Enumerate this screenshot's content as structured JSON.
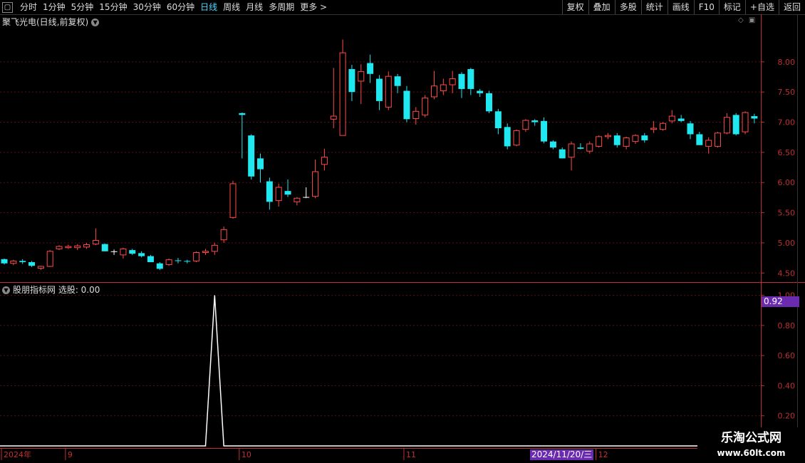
{
  "toolbar": {
    "tabs": [
      "分时",
      "1分钟",
      "5分钟",
      "15分钟",
      "30分钟",
      "60分钟",
      "日线",
      "周线",
      "月线",
      "多周期",
      "更多 >"
    ],
    "active_tab": "日线",
    "right_buttons": [
      "复权",
      "叠加",
      "多股",
      "统计",
      "画线",
      "F10",
      "标记",
      "+自选",
      "返回"
    ]
  },
  "stock": {
    "title": "聚飞光电(日线,前复权)"
  },
  "indicator": {
    "title": "股朋指标网 选股: 0.00",
    "current_value": "0.92"
  },
  "watermark": {
    "line1": "乐淘公式网",
    "line2": "www.60lt.com"
  },
  "cursor_date": "2024/11/20/三",
  "colors": {
    "up": "#ff4a4a",
    "down": "#20e8f0",
    "grid": "#5a1010",
    "axis": "#c03030"
  },
  "chart_data": [
    {
      "type": "candlestick",
      "ylim": [
        4.35,
        8.6
      ],
      "y_ticks": [
        4.5,
        5.0,
        5.5,
        6.0,
        6.5,
        7.0,
        7.5,
        8.0
      ],
      "x_ticks": [
        "2024年",
        "9",
        "10",
        "11",
        "12"
      ],
      "x_tick_index": [
        0,
        7,
        26,
        44,
        65
      ],
      "ohlc": [
        [
          4.73,
          4.74,
          4.64,
          4.66
        ],
        [
          4.66,
          4.72,
          4.63,
          4.7
        ],
        [
          4.7,
          4.73,
          4.65,
          4.68
        ],
        [
          4.68,
          4.7,
          4.6,
          4.62
        ],
        [
          4.58,
          4.62,
          4.55,
          4.61
        ],
        [
          4.61,
          4.88,
          4.6,
          4.86
        ],
        [
          4.9,
          4.96,
          4.88,
          4.94
        ],
        [
          4.92,
          4.97,
          4.9,
          4.94
        ],
        [
          4.92,
          4.98,
          4.88,
          4.95
        ],
        [
          4.93,
          5.0,
          4.9,
          4.97
        ],
        [
          4.98,
          5.24,
          4.96,
          5.04
        ],
        [
          4.98,
          4.99,
          4.86,
          4.86
        ],
        [
          4.86,
          4.89,
          4.8,
          4.86
        ],
        [
          4.8,
          4.92,
          4.74,
          4.9
        ],
        [
          4.88,
          4.9,
          4.8,
          4.82
        ],
        [
          4.83,
          4.86,
          4.76,
          4.78
        ],
        [
          4.78,
          4.8,
          4.68,
          4.68
        ],
        [
          4.66,
          4.68,
          4.55,
          4.57
        ],
        [
          4.64,
          4.74,
          4.62,
          4.72
        ],
        [
          4.71,
          4.75,
          4.66,
          4.7
        ],
        [
          4.7,
          4.72,
          4.66,
          4.69
        ],
        [
          4.7,
          4.86,
          4.68,
          4.84
        ],
        [
          4.84,
          4.9,
          4.8,
          4.86
        ],
        [
          4.86,
          5.0,
          4.8,
          4.96
        ],
        [
          5.05,
          5.27,
          5.0,
          5.22
        ],
        [
          5.42,
          6.03,
          5.4,
          5.98
        ],
        [
          7.15,
          7.16,
          6.4,
          7.12
        ],
        [
          6.78,
          6.8,
          6.05,
          6.1
        ],
        [
          6.4,
          6.48,
          6.0,
          6.22
        ],
        [
          6.02,
          6.08,
          5.55,
          5.68
        ],
        [
          5.7,
          5.98,
          5.6,
          5.92
        ],
        [
          5.86,
          6.05,
          5.76,
          5.8
        ],
        [
          5.68,
          5.76,
          5.62,
          5.74
        ],
        [
          5.76,
          5.92,
          5.74,
          5.76
        ],
        [
          5.77,
          6.38,
          5.74,
          6.18
        ],
        [
          6.3,
          6.56,
          6.2,
          6.42
        ],
        [
          7.05,
          7.9,
          6.9,
          7.1
        ],
        [
          6.78,
          8.37,
          6.78,
          8.15
        ],
        [
          7.88,
          7.95,
          7.35,
          7.5
        ],
        [
          7.68,
          7.96,
          7.3,
          7.84
        ],
        [
          7.98,
          8.12,
          7.65,
          7.8
        ],
        [
          7.72,
          7.78,
          7.2,
          7.35
        ],
        [
          7.25,
          7.84,
          7.2,
          7.76
        ],
        [
          7.76,
          7.8,
          7.48,
          7.6
        ],
        [
          7.52,
          7.6,
          7.0,
          7.05
        ],
        [
          7.06,
          7.25,
          6.96,
          7.18
        ],
        [
          7.12,
          7.45,
          7.08,
          7.4
        ],
        [
          7.42,
          7.85,
          7.38,
          7.6
        ],
        [
          7.52,
          7.72,
          7.45,
          7.62
        ],
        [
          7.62,
          7.85,
          7.48,
          7.72
        ],
        [
          7.8,
          7.83,
          7.4,
          7.55
        ],
        [
          7.88,
          7.9,
          7.45,
          7.55
        ],
        [
          7.52,
          7.55,
          7.42,
          7.48
        ],
        [
          7.48,
          7.52,
          7.15,
          7.18
        ],
        [
          7.18,
          7.22,
          6.8,
          6.9
        ],
        [
          6.92,
          6.98,
          6.55,
          6.6
        ],
        [
          6.62,
          6.88,
          6.6,
          6.86
        ],
        [
          6.88,
          7.05,
          6.84,
          7.03
        ],
        [
          7.03,
          7.05,
          6.94,
          7.0
        ],
        [
          7.02,
          7.08,
          6.65,
          6.68
        ],
        [
          6.68,
          6.7,
          6.55,
          6.58
        ],
        [
          6.55,
          6.58,
          6.4,
          6.4
        ],
        [
          6.42,
          6.68,
          6.2,
          6.64
        ],
        [
          6.58,
          6.65,
          6.55,
          6.56
        ],
        [
          6.52,
          6.68,
          6.48,
          6.64
        ],
        [
          6.6,
          6.78,
          6.58,
          6.76
        ],
        [
          6.76,
          6.82,
          6.72,
          6.78
        ],
        [
          6.78,
          6.82,
          6.58,
          6.62
        ],
        [
          6.6,
          6.76,
          6.55,
          6.74
        ],
        [
          6.68,
          6.8,
          6.64,
          6.78
        ],
        [
          6.78,
          6.82,
          6.66,
          6.7
        ],
        [
          6.88,
          7.02,
          6.82,
          6.9
        ],
        [
          6.88,
          7.0,
          6.86,
          6.98
        ],
        [
          7.02,
          7.2,
          6.98,
          7.1
        ],
        [
          7.06,
          7.12,
          7.0,
          7.02
        ],
        [
          6.98,
          7.02,
          6.72,
          6.8
        ],
        [
          6.8,
          6.84,
          6.62,
          6.62
        ],
        [
          6.6,
          6.75,
          6.48,
          6.7
        ],
        [
          6.6,
          6.84,
          6.58,
          6.82
        ],
        [
          6.82,
          7.15,
          6.8,
          7.08
        ],
        [
          7.12,
          7.15,
          6.78,
          6.8
        ],
        [
          6.84,
          7.18,
          6.8,
          7.16
        ],
        [
          7.1,
          7.14,
          6.98,
          7.06
        ]
      ]
    },
    {
      "type": "line",
      "ylim": [
        0,
        1.05
      ],
      "y_ticks": [
        0.2,
        0.4,
        0.6,
        0.8,
        1.0
      ],
      "spike_index": 23,
      "values_zero_except_spike": 1.0
    }
  ]
}
